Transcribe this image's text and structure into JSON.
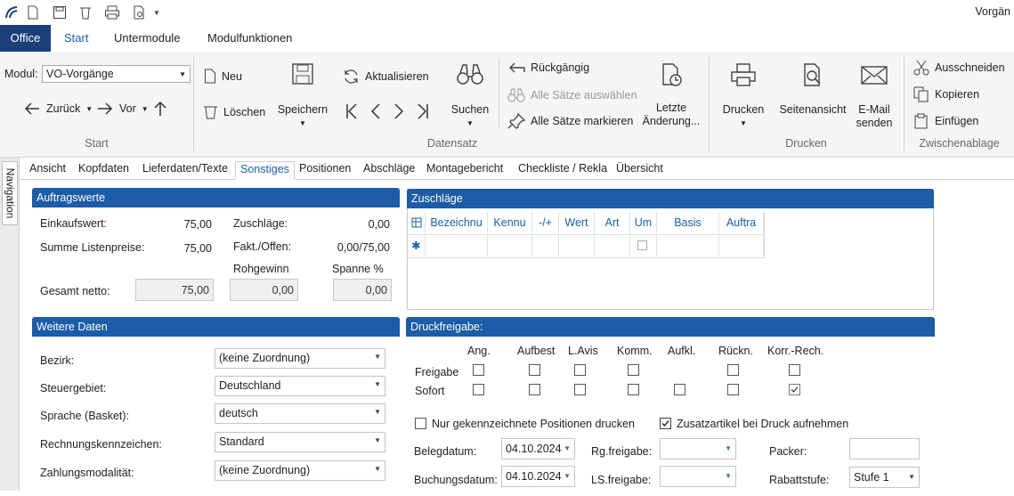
{
  "app": {
    "title": "Vorgän"
  },
  "ribbon_tabs": [
    "Office",
    "Start",
    "Untermodule",
    "Modulfunktionen"
  ],
  "start_group": {
    "modul_label": "Modul:",
    "modul_value": "VO-Vorgänge",
    "back": "Zurück",
    "forward": "Vor",
    "label": "Start"
  },
  "datensatz": {
    "neu": "Neu",
    "loeschen": "Löschen",
    "speichern": "Speichern",
    "aktualisieren": "Aktualisieren",
    "suchen": "Suchen",
    "rueckgaengig": "Rückgängig",
    "alle_auswaehlen": "Alle Sätze auswählen",
    "alle_markieren": "Alle Sätze markieren",
    "letzte_aenderung_1": "Letzte",
    "letzte_aenderung_2": "Änderung...",
    "label": "Datensatz"
  },
  "drucken_group": {
    "drucken": "Drucken",
    "seitenansicht": "Seitenansicht",
    "email_1": "E-Mail",
    "email_2": "senden",
    "label": "Drucken"
  },
  "clipboard": {
    "ausschneiden": "Ausschneiden",
    "kopieren": "Kopieren",
    "einfuegen": "Einfügen",
    "label": "Zwischenablage"
  },
  "navigation": "Navigation",
  "page_tabs": [
    "Ansicht",
    "Kopfdaten",
    "Lieferdaten/Texte",
    "Sonstiges",
    "Positionen",
    "Abschläge",
    "Montagebericht",
    "Checkliste / Rekla",
    "Übersicht"
  ],
  "auftragswerte": {
    "title": "Auftragswerte",
    "einkaufswert_label": "Einkaufswert:",
    "einkaufswert": "75,00",
    "summe_label": "Summe Listenpreise:",
    "summe": "75,00",
    "zuschlaege_label": "Zuschläge:",
    "zuschlaege": "0,00",
    "fakt_label": "Fakt./Offen:",
    "fakt": "0,00/75,00",
    "rohgewinn_label": "Rohgewinn",
    "spanne_label": "Spanne %",
    "gesamt_label": "Gesamt netto:",
    "gesamt": "75,00",
    "rohgewinn": "0,00",
    "spanne": "0,00"
  },
  "zuschlaege_panel": {
    "title": "Zuschläge",
    "columns": [
      "Bezeichnu",
      "Kennu",
      "-/+",
      "Wert",
      "Art",
      "Um",
      "Basis",
      "Auftra"
    ]
  },
  "weitere_daten": {
    "title": "Weitere Daten",
    "rows": [
      {
        "label": "Bezirk:",
        "value": "(keine Zuordnung)"
      },
      {
        "label": "Steuergebiet:",
        "value": "Deutschland"
      },
      {
        "label": "Sprache (Basket):",
        "value": "deutsch"
      },
      {
        "label": "Rechnungskennzeichen:",
        "value": "Standard"
      },
      {
        "label": "Zahlungsmodalität:",
        "value": "(keine Zuordnung)"
      }
    ]
  },
  "druckfreigabe": {
    "title": "Druckfreigabe:",
    "columns": [
      "Ang.",
      "Aufbest",
      "L.Avis",
      "Komm.",
      "Aufkl.",
      "Rückn.",
      "Korr.-Rech."
    ],
    "row_freigabe": "Freigabe",
    "row_sofort": "Sofort",
    "nur_gekennzeichnete": "Nur gekennzeichnete Positionen drucken",
    "zusatzartikel": "Zusatzartikel bei Druck aufnehmen",
    "belegdatum_label": "Belegdatum:",
    "belegdatum": "04.10.2024",
    "buchungsdatum_label": "Buchungsdatum:",
    "buchungsdatum": "04.10.2024",
    "rgfreigabe_label": "Rg.freigabe:",
    "lsfreigabe_label": "LS.freigabe:",
    "packer_label": "Packer:",
    "rabattstufe_label": "Rabattstufe:",
    "rabattstufe": "Stufe 1"
  }
}
